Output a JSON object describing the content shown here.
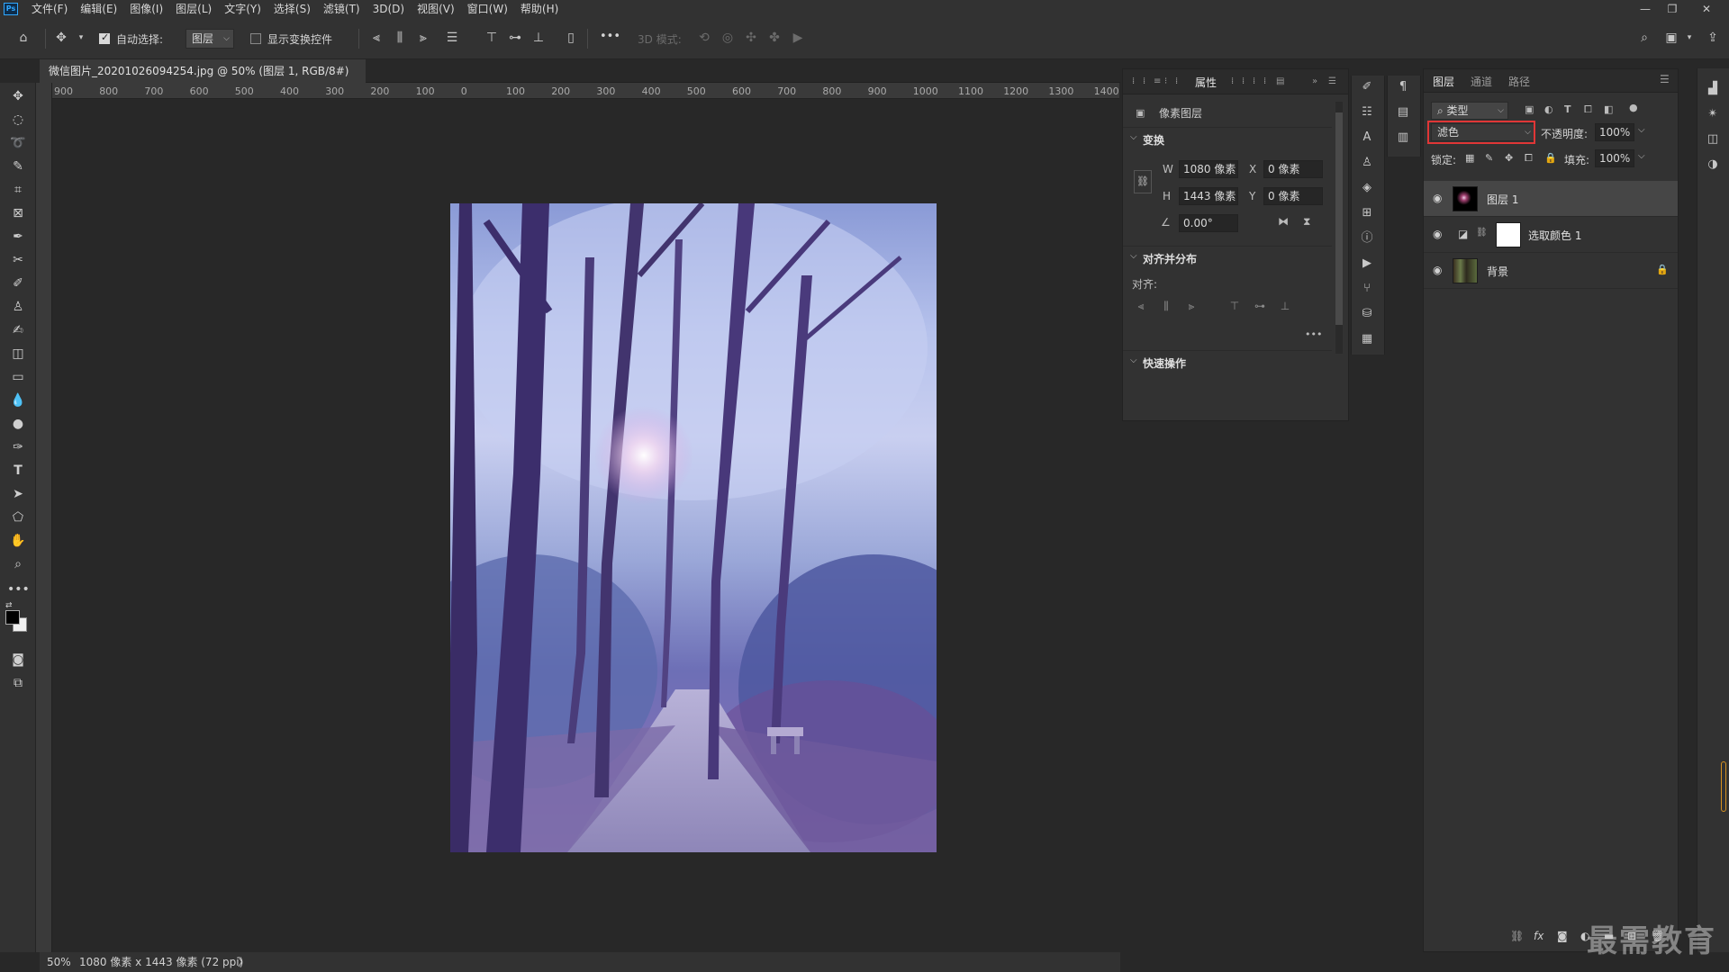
{
  "menubar": {
    "logo": "Ps",
    "items": [
      "文件(F)",
      "编辑(E)",
      "图像(I)",
      "图层(L)",
      "文字(Y)",
      "选择(S)",
      "滤镜(T)",
      "3D(D)",
      "视图(V)",
      "窗口(W)",
      "帮助(H)"
    ],
    "minimize": "—",
    "restore": "❐",
    "close": "✕"
  },
  "options": {
    "auto_select_label": "自动选择:",
    "auto_select_checked": true,
    "auto_select_target": "图层",
    "show_transform_label": "显示变换控件",
    "more": "•••",
    "mode_3d_label": "3D 模式:"
  },
  "document": {
    "tab_title": "微信图片_20201026094254.jpg @ 50% (图层 1, RGB/8#) *",
    "tab_close": "×"
  },
  "ruler_top": [
    "900",
    "800",
    "700",
    "600",
    "500",
    "400",
    "300",
    "200",
    "100",
    "0",
    "100",
    "200",
    "300",
    "400",
    "500",
    "600",
    "700",
    "800",
    "900",
    "1000",
    "1100",
    "1200",
    "1300",
    "1400"
  ],
  "status": {
    "zoom": "50%",
    "info": "1080 像素 x 1443 像素 (72 ppi)",
    "arrow": "〉"
  },
  "properties": {
    "tab_label": "属性",
    "layer_type": "像素图层",
    "transform_title": "变换",
    "w_label": "W",
    "w_value": "1080 像素",
    "h_label": "H",
    "h_value": "1443 像素",
    "x_label": "X",
    "x_value": "0 像素",
    "y_label": "Y",
    "y_value": "0 像素",
    "angle_value": "0.00°",
    "align_title": "对齐并分布",
    "align_label": "对齐:",
    "align_more": "•••",
    "quick_title": "快速操作"
  },
  "layers_panel": {
    "tabs": [
      "图层",
      "通道",
      "路径"
    ],
    "filter_label": "类型",
    "blend_mode": "滤色",
    "opacity_label": "不透明度:",
    "opacity_value": "100%",
    "lock_label": "锁定:",
    "fill_label": "填充:",
    "fill_value": "100%",
    "layers": [
      {
        "name": "图层 1",
        "selected": true
      },
      {
        "name": "选取颜色 1",
        "selected": false
      },
      {
        "name": "背景",
        "selected": false
      }
    ]
  },
  "watermark": "最需教育",
  "colors": {
    "accent_red": "#e03636",
    "panel_bg": "#323232",
    "canvas_bg": "#282828"
  }
}
